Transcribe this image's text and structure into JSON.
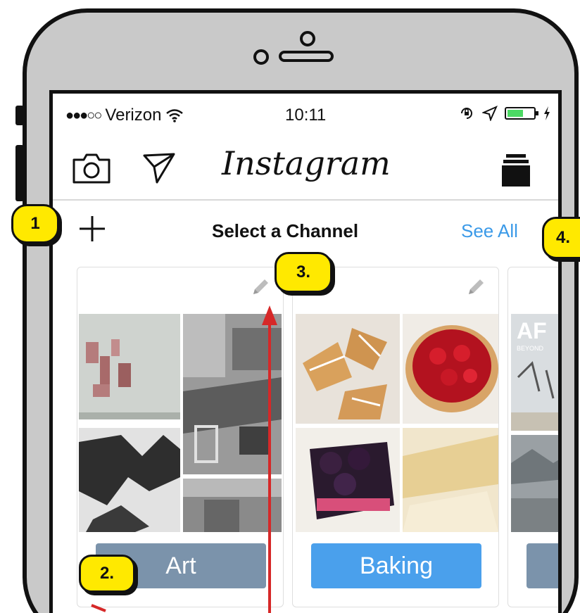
{
  "status_bar": {
    "signal": "●●●○○",
    "carrier": "Verizon",
    "time": "10:11",
    "battery_level": 0.6
  },
  "nav": {
    "brand": "Instagram",
    "camera_icon": "camera-icon",
    "send_icon": "paper-plane-icon",
    "stack_icon": "stack-icon"
  },
  "channel_header": {
    "title": "Select a Channel",
    "see_all_label": "See All",
    "add_icon": "plus-icon"
  },
  "channels": [
    {
      "label": "Art",
      "button_color": "#7b93ab"
    },
    {
      "label": "Baking",
      "button_color": "#4aa0ec"
    },
    {
      "label": "",
      "button_color": "#7b93ab"
    }
  ],
  "peek_card_text": {
    "title": "AF",
    "subtitle": "BEYOND"
  },
  "callouts": [
    "1",
    "2.",
    "3.",
    "4."
  ],
  "colors": {
    "link": "#3b9ae8",
    "callout": "#ffe900",
    "arrow": "#d62828",
    "battery": "#4cd964"
  }
}
